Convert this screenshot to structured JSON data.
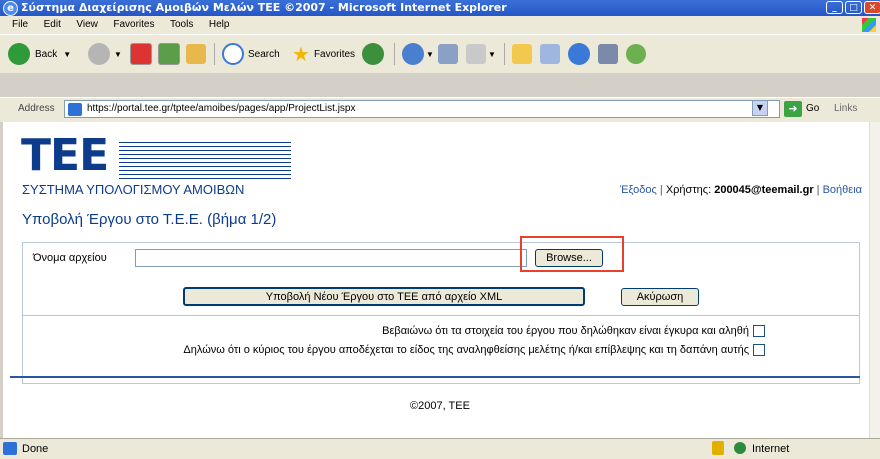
{
  "window": {
    "title": "Σύστημα Διαχείρισης Αμοιβών Μελών ΤΕΕ ©2007 - Microsoft Internet Explorer"
  },
  "menu": [
    "File",
    "Edit",
    "View",
    "Favorites",
    "Tools",
    "Help"
  ],
  "toolbar": {
    "back": "Back",
    "search": "Search",
    "favorites": "Favorites"
  },
  "address": {
    "label": "Address",
    "url": "https://portal.tee.gr/tptee/amoibes/pages/app/ProjectList.jspx",
    "go": "Go",
    "links": "Links"
  },
  "header": {
    "logo_text": "ΤΕΕ",
    "system_name": "ΣΥΣΤΗΜΑ ΥΠΟΛΟΓΙΣΜΟΥ ΑΜΟΙΒΩΝ",
    "logout": "Έξοδος",
    "user_label": "Χρήστης:",
    "user_email": "200045@teemail.gr",
    "help": "Βοήθεια"
  },
  "page": {
    "title": "Υποβολή Έργου στο Τ.Ε.Ε. (βήμα 1/2)"
  },
  "form": {
    "file_label": "Όνομα αρχείου",
    "file_value": "",
    "browse_label": "Browse...",
    "submit_label": "Υποβολή Νέου Έργου στο ΤΕΕ από αρχείο XML",
    "cancel_label": "Ακύρωση",
    "confirm1": "Βεβαιώνω ότι τα στοιχεία του έργου που δηλώθηκαν είναι έγκυρα και αληθή",
    "confirm2": "Δηλώνω ότι ο κύριος του έργου αποδέχεται το είδος της αναληφθείσης μελέτης ή/και επίβλεψης και τη δαπάνη αυτής",
    "confirm1_checked": false,
    "confirm2_checked": false
  },
  "footer": {
    "copyright": "©2007, ΤΕΕ"
  },
  "status": {
    "text": "Done",
    "zone": "Internet"
  },
  "colors": {
    "accent": "#0d3c8c",
    "link": "#2b56a6",
    "highlight": "#e8402a"
  }
}
